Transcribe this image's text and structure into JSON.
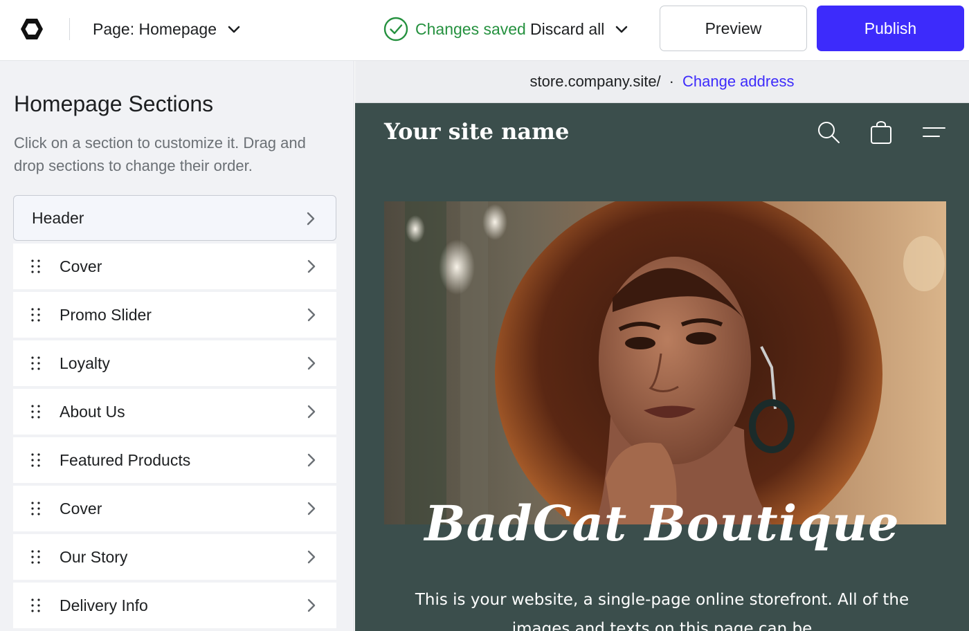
{
  "toolbar": {
    "page_label": "Page: Homepage",
    "status": "Changes saved",
    "discard_label": "Discard all",
    "preview_label": "Preview",
    "publish_label": "Publish",
    "colors": {
      "publish": "#3d2bfb",
      "saved": "#25913f"
    }
  },
  "sidebar": {
    "title": "Homepage Sections",
    "description": "Click on a section to customize it. Drag and drop sections to change their order.",
    "sections": [
      {
        "label": "Header"
      },
      {
        "label": "Cover"
      },
      {
        "label": "Promo Slider"
      },
      {
        "label": "Loyalty"
      },
      {
        "label": "About Us"
      },
      {
        "label": "Featured Products"
      },
      {
        "label": "Cover"
      },
      {
        "label": "Our Story"
      },
      {
        "label": "Delivery Info"
      }
    ]
  },
  "address": {
    "url": "store.company.site/",
    "separator": "·",
    "change_label": "Change address"
  },
  "site": {
    "name": "Your site name",
    "hero_title": "BadCat Boutique",
    "hero_text": "This is your website, a single-page online storefront. All of the images and texts on this page can be",
    "background": "#3b4e4c",
    "icons": [
      "search-icon",
      "shopping-bag-icon",
      "menu-icon"
    ]
  }
}
